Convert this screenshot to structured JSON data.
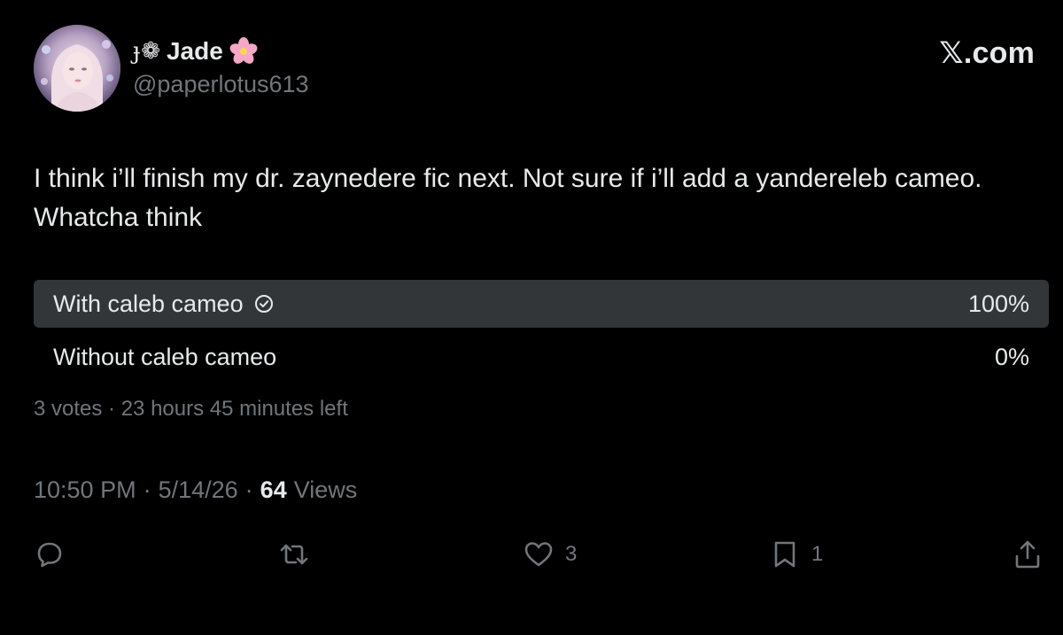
{
  "header": {
    "name_prefix": "ɟ❁",
    "display_name": "Jade",
    "handle": "@paperlotus613",
    "brand": "𝕏.com"
  },
  "tweet": {
    "text": "I think i’ll finish my dr. zaynedere fic next. Not sure if i’ll add a yandereleb cameo. Whatcha think"
  },
  "poll": {
    "options": [
      {
        "label": "With caleb cameo",
        "percent_text": "100%",
        "percent": 100,
        "selected": true
      },
      {
        "label": "Without caleb cameo",
        "percent_text": "0%",
        "percent": 0,
        "selected": false
      }
    ],
    "meta": "3 votes · 23 hours 45 minutes left"
  },
  "meta": {
    "time": "10:50 PM",
    "date": "5/14/26",
    "views_count": "64",
    "views_label": "Views"
  },
  "actions": {
    "reply_count": "",
    "retweet_count": "",
    "like_count": "3",
    "bookmark_count": "1"
  },
  "icons": {
    "reply": "reply-icon",
    "retweet": "retweet-icon",
    "like": "heart-icon",
    "bookmark": "bookmark-icon",
    "share": "share-icon",
    "flower": "cherry-blossom-icon",
    "check": "check-circle-icon"
  },
  "colors": {
    "background": "#000000",
    "text": "#e7e9ea",
    "secondary": "#71767b",
    "poll_fill": "#333639",
    "flower": "#f4a7c6"
  }
}
